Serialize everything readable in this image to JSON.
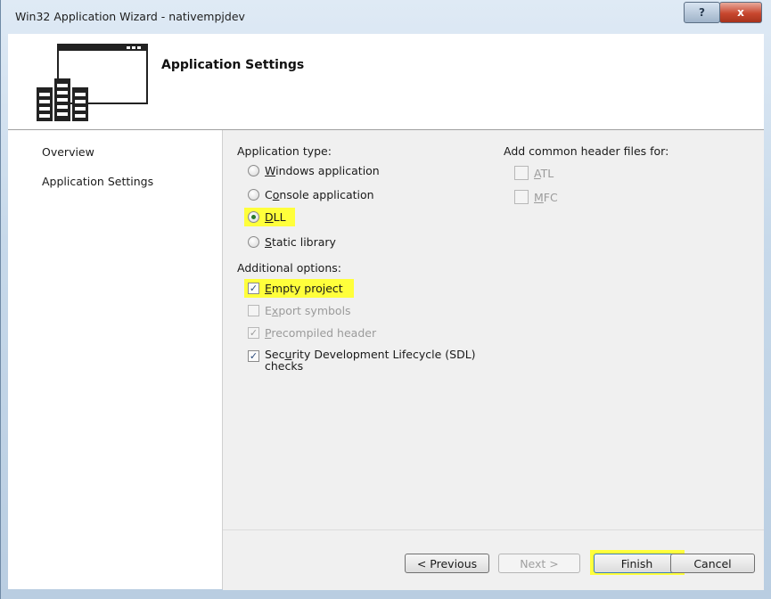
{
  "window": {
    "title": "Win32 Application Wizard - nativempjdev",
    "help_label": "?",
    "close_label": "x"
  },
  "header": {
    "title": "Application Settings"
  },
  "nav": {
    "items": [
      {
        "label": "Overview"
      },
      {
        "label": "Application Settings"
      }
    ]
  },
  "app_type": {
    "label": "Application type:",
    "options": [
      {
        "prefix": "",
        "accel": "W",
        "rest": "indows application",
        "selected": false
      },
      {
        "prefix": "C",
        "accel": "o",
        "rest": "nsole application",
        "selected": false
      },
      {
        "prefix": "",
        "accel": "D",
        "rest": "LL",
        "selected": true
      },
      {
        "prefix": "",
        "accel": "S",
        "rest": "tatic library",
        "selected": false
      }
    ]
  },
  "additional": {
    "label": "Additional options:",
    "options": [
      {
        "prefix": "",
        "accel": "E",
        "rest": "mpty project",
        "checked": true,
        "enabled": true
      },
      {
        "prefix": "E",
        "accel": "x",
        "rest": "port symbols",
        "checked": false,
        "enabled": false
      },
      {
        "prefix": "",
        "accel": "P",
        "rest": "recompiled header",
        "checked": true,
        "enabled": false
      },
      {
        "prefix": "Sec",
        "accel": "u",
        "rest": "rity Development Lifecycle (SDL)",
        "line2": "checks",
        "checked": true,
        "enabled": true
      }
    ]
  },
  "common_headers": {
    "label": "Add common header files for:",
    "options": [
      {
        "prefix": "",
        "accel": "A",
        "rest": "TL",
        "checked": false,
        "enabled": false
      },
      {
        "prefix": "",
        "accel": "M",
        "rest": "FC",
        "checked": false,
        "enabled": false
      }
    ]
  },
  "footer": {
    "previous_label": "< Previous",
    "next_label": "Next >",
    "finish_label": "Finish",
    "cancel_label": "Cancel"
  },
  "colors": {
    "highlight": "#ffff3b",
    "radio_dot": "#2a7a2a"
  }
}
